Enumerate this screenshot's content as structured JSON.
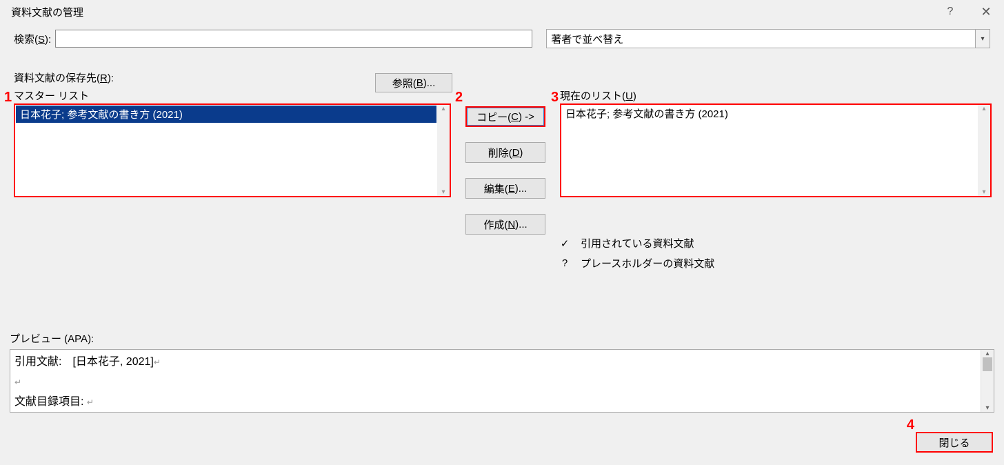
{
  "title": "資料文献の管理",
  "search": {
    "label_pre": "検索(",
    "label_key": "S",
    "label_post": "):",
    "value": ""
  },
  "sort": {
    "value": "著者で並べ替え"
  },
  "save_dest": {
    "label_pre": "資料文献の保存先(",
    "label_key": "R",
    "label_post": "):"
  },
  "master_label": "マスター リスト",
  "browse": {
    "label_pre": "参照(",
    "label_key": "B",
    "label_post": ")..."
  },
  "master_items": [
    "日本花子; 参考文献の書き方 (2021)"
  ],
  "current_label_pre": "現在のリスト(",
  "current_label_key": "U",
  "current_label_post": ")",
  "current_items": [
    "日本花子; 参考文献の書き方 (2021)"
  ],
  "actions": {
    "copy_pre": "コピー(",
    "copy_key": "C",
    "copy_post": ") ->",
    "delete_pre": "削除(",
    "delete_key": "D",
    "delete_post": ")",
    "edit_pre": "編集(",
    "edit_key": "E",
    "edit_post": ")...",
    "new_pre": "作成(",
    "new_key": "N",
    "new_post": ")..."
  },
  "legend": {
    "cited_mark": "✓",
    "cited": "引用されている資料文献",
    "placeholder_mark": "?",
    "placeholder": "プレースホルダーの資料文献"
  },
  "preview": {
    "label": "プレビュー (APA):",
    "line1_pre": "引用文献:　",
    "line1_val": "[日本花子, 2021]",
    "line2": "文献目録項目: "
  },
  "close": "閉じる",
  "annot": {
    "a1": "1",
    "a2": "2",
    "a3": "3",
    "a4": "4"
  }
}
